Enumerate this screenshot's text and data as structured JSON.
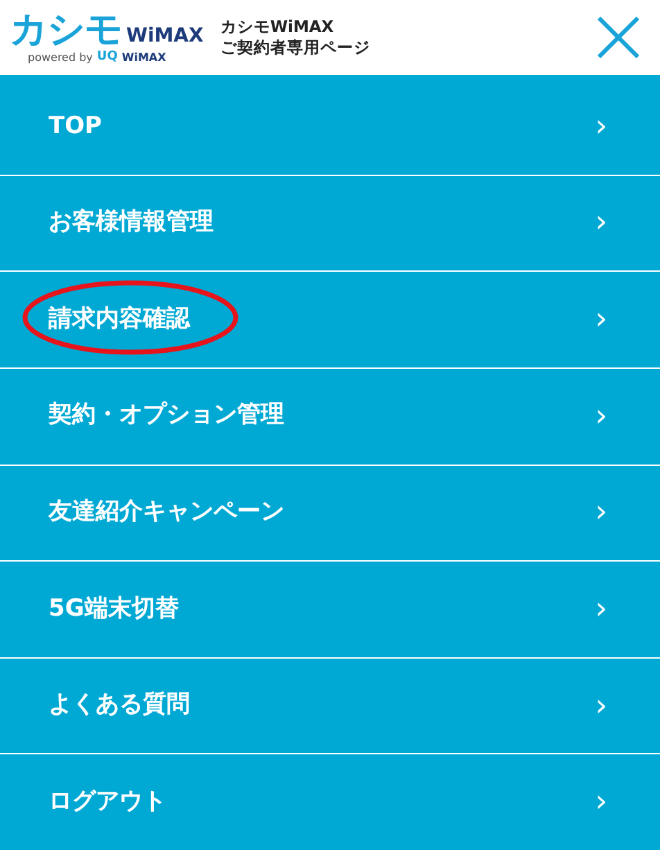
{
  "header": {
    "logo": {
      "brand": "カシモ",
      "product": "WiMAX",
      "powered": "powered by",
      "partner_mark": "UQ",
      "partner_name": "WiMAX"
    },
    "site_title": [
      "カシモWiMAX",
      "ご契約者専用ページ"
    ]
  },
  "menu": [
    {
      "label": "TOP",
      "circled": false,
      "chevron": "›"
    },
    {
      "label": "お客様情報管理",
      "circled": false,
      "chevron": "›"
    },
    {
      "label": "請求内容確認",
      "circled": true,
      "chevron": "›"
    },
    {
      "label": "契約・オプション管理",
      "circled": false,
      "chevron": "›"
    },
    {
      "label": "友達紹介キャンペーン",
      "circled": false,
      "chevron": "›"
    },
    {
      "label": "5G端末切替",
      "circled": false,
      "chevron": "›"
    },
    {
      "label": "よくある質問",
      "circled": false,
      "chevron": "›"
    },
    {
      "label": "ログアウト",
      "circled": false,
      "chevron": "›"
    }
  ]
}
